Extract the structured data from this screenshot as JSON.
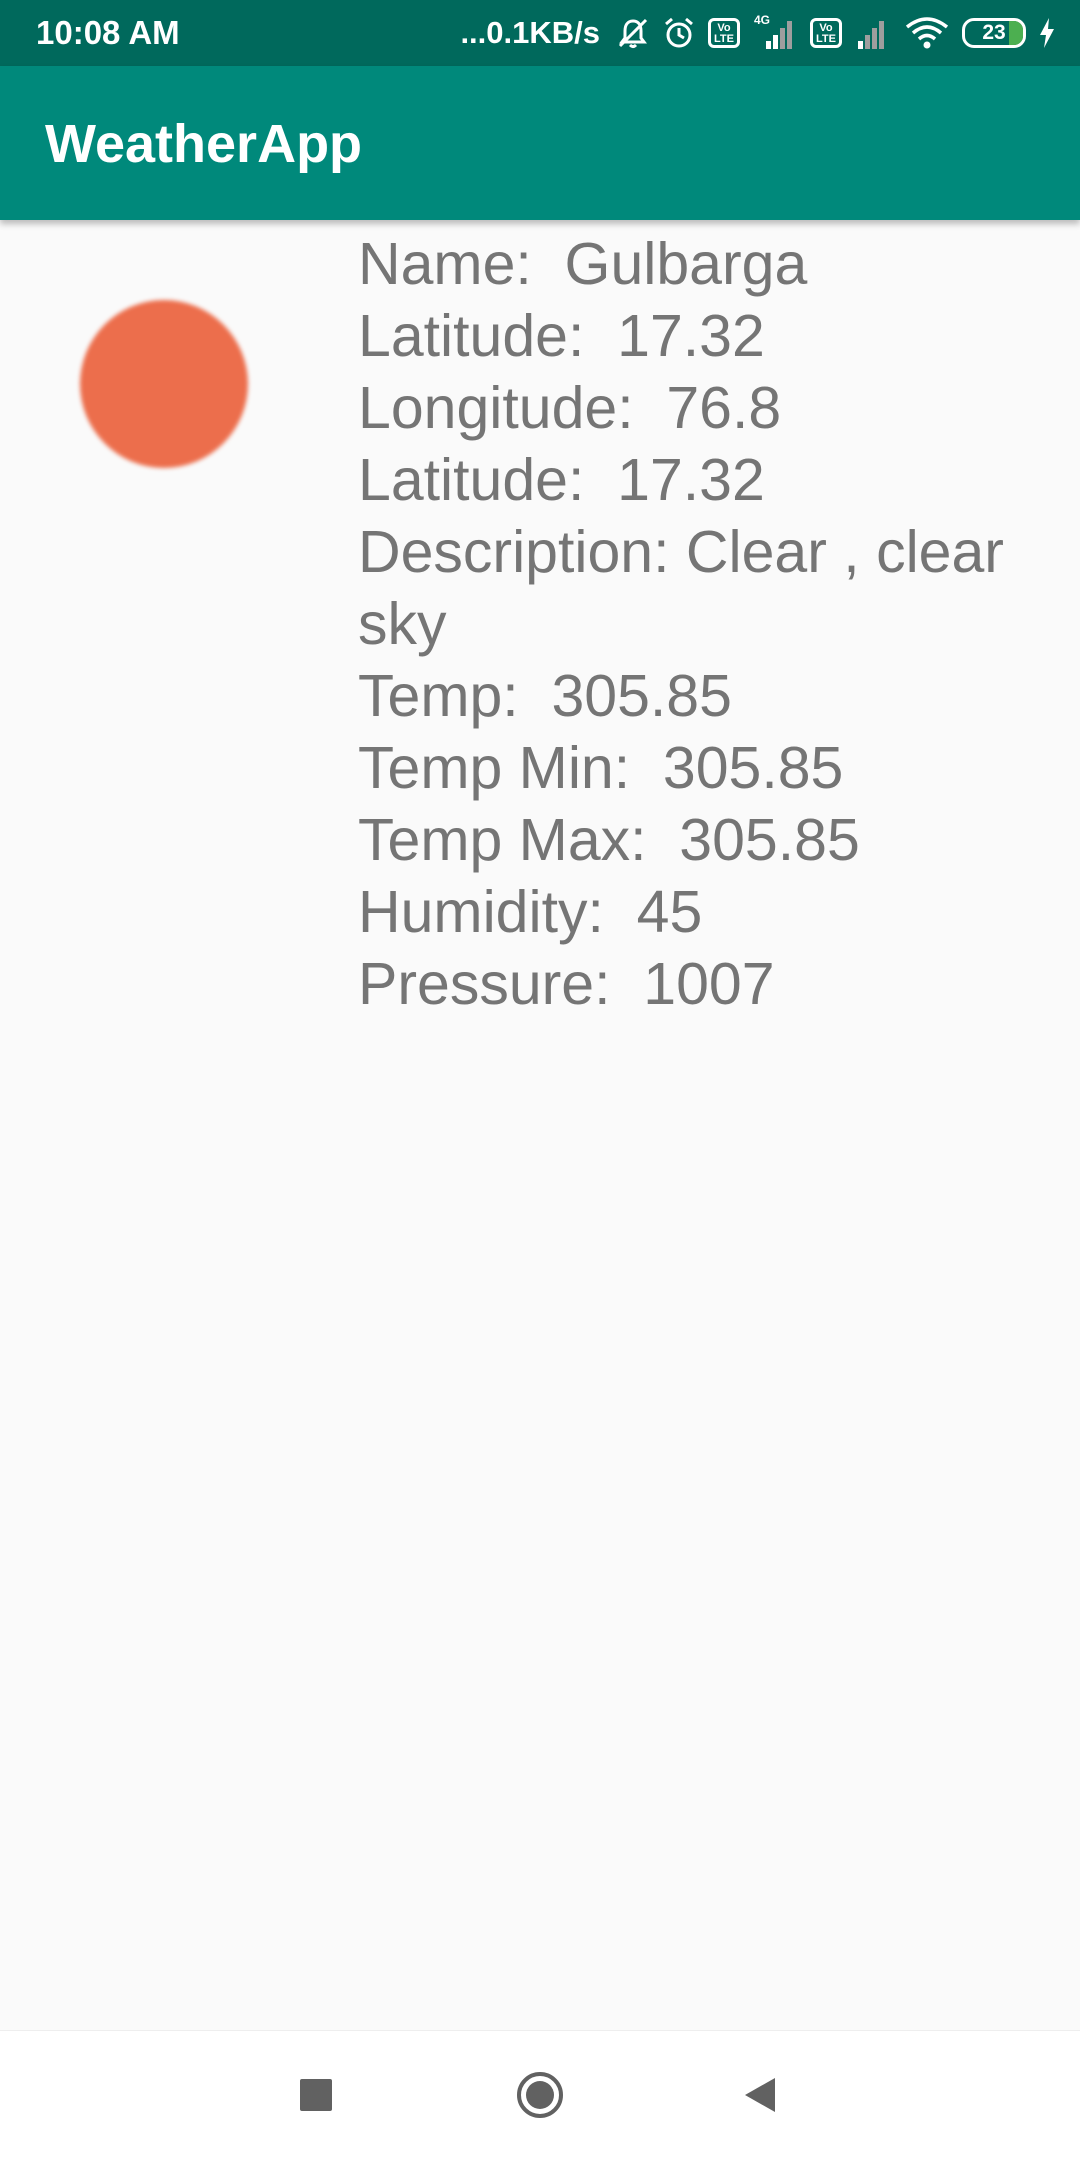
{
  "status_bar": {
    "time": "10:08 AM",
    "network_speed": "...0.1KB/s",
    "network_type": "4G",
    "volte_label": "Vo\nLTE",
    "battery_level": "23",
    "icons": [
      "dnd-off-icon",
      "alarm-icon",
      "volte-icon",
      "signal-icon",
      "volte-icon",
      "signal-icon",
      "wifi-icon",
      "battery-icon",
      "charging-icon"
    ]
  },
  "app_bar": {
    "title": "WeatherApp"
  },
  "weather": {
    "icon": "weather-condition-icon",
    "icon_color": "#ec6e4c",
    "lines": [
      "Name:  Gulbarga",
      "Latitude:  17.32",
      "Longitude:  76.8",
      "Latitude:  17.32",
      "Description: Clear , clear sky",
      "Temp:  305.85",
      "Temp Min:  305.85",
      "Temp Max:  305.85",
      "Humidity:  45",
      "Pressure:  1007"
    ]
  },
  "nav_bar": {
    "buttons": [
      "recent-apps-icon",
      "home-icon",
      "back-icon"
    ]
  },
  "colors": {
    "status_bar": "#00695c",
    "app_bar": "#00897b",
    "background": "#fafafa",
    "text": "#757575"
  }
}
